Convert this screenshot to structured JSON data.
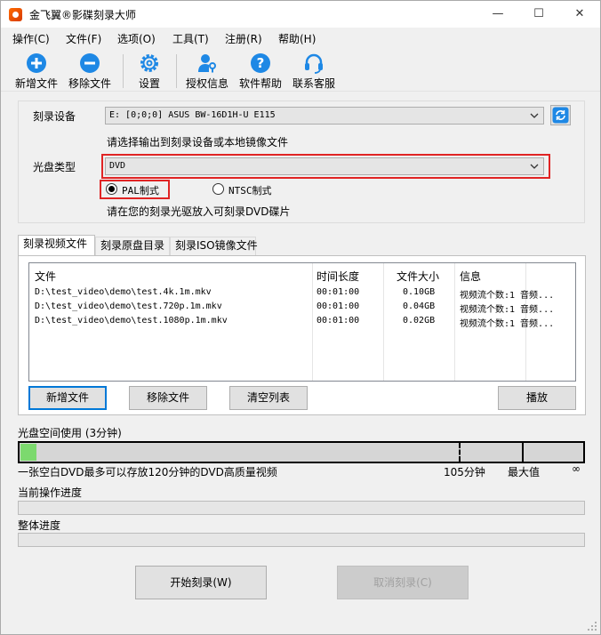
{
  "window": {
    "title": "金飞翼®影碟刻录大师"
  },
  "menu": [
    "操作(C)",
    "文件(F)",
    "选项(O)",
    "工具(T)",
    "注册(R)",
    "帮助(H)"
  ],
  "toolbar": {
    "add_file": "新增文件",
    "remove_file": "移除文件",
    "settings": "设置",
    "license": "授权信息",
    "help": "软件帮助",
    "support": "联系客服"
  },
  "burner": {
    "label": "刻录设备",
    "device": "E:  [0;0;0] ASUS BW-16D1H-U E115",
    "hint": "请选择输出到刻录设备或本地镜像文件"
  },
  "disc": {
    "label": "光盘类型",
    "type": "DVD",
    "pal": "PAL制式",
    "ntsc": "NTSC制式",
    "hint": "请在您的刻录光驱放入可刻录DVD碟片"
  },
  "tabs": [
    "刻录视频文件",
    "刻录原盘目录",
    "刻录ISO镜像文件"
  ],
  "table": {
    "headers": [
      "文件",
      "时间长度",
      "文件大小",
      "信息"
    ],
    "rows": [
      [
        "D:\\test_video\\demo\\test.4k.1m.mkv",
        "00:01:00",
        "0.10GB",
        "视频流个数:1 音频..."
      ],
      [
        "D:\\test_video\\demo\\test.720p.1m.mkv",
        "00:01:00",
        "0.04GB",
        "视频流个数:1 音频..."
      ],
      [
        "D:\\test_video\\demo\\test.1080p.1m.mkv",
        "00:01:00",
        "0.02GB",
        "视频流个数:1 音频..."
      ]
    ]
  },
  "buttons": {
    "add": "新增文件",
    "remove": "移除文件",
    "clear": "清空列表",
    "play": "播放"
  },
  "usage": {
    "title": "光盘空间使用 (3分钟)",
    "used_minutes": 3,
    "mark_minutes": 105,
    "max_minutes": 120,
    "note": "一张空白DVD最多可以存放120分钟的DVD高质量视频",
    "mark_label": "105分钟",
    "max_label": "最大值",
    "inf_label": "∞"
  },
  "progress": {
    "current": "当前操作进度",
    "overall": "整体进度"
  },
  "actions": {
    "start": "开始刻录(W)",
    "cancel": "取消刻录(C)"
  },
  "colors": {
    "accent": "#1e88e5",
    "highlight": "#e02424",
    "fill": "#7cd96e"
  }
}
